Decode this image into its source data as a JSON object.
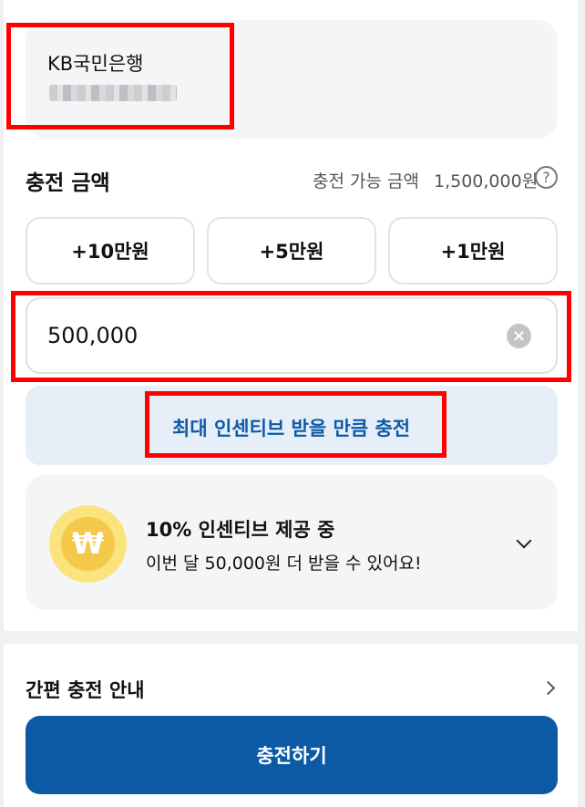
{
  "account": {
    "bank_name": "KB국민은행"
  },
  "amount": {
    "title": "충전 금액",
    "available_label": "충전 가능 금액",
    "available_value": "1,500,000원",
    "help_icon": "?"
  },
  "quick_add": [
    {
      "label": "+10만원"
    },
    {
      "label": "+5만원"
    },
    {
      "label": "+1만원"
    }
  ],
  "input": {
    "value": "500,000",
    "clear_icon": "×"
  },
  "max_incentive": {
    "label": "최대 인센티브 받을 만큼 충전"
  },
  "incentive": {
    "coin_symbol": "₩",
    "title": "10% 인센티브 제공 중",
    "subtitle": "이번 달 50,000원 더 받을 수 있어요!"
  },
  "guide": {
    "label": "간편 충전 안내"
  },
  "charge_button": {
    "label": "충전하기"
  },
  "colors": {
    "primary": "#0c5aa6",
    "highlight": "#ff0000",
    "card_bg": "#f4f5f7",
    "max_button_bg": "#e6eef8",
    "coin": "#f4c94b"
  }
}
